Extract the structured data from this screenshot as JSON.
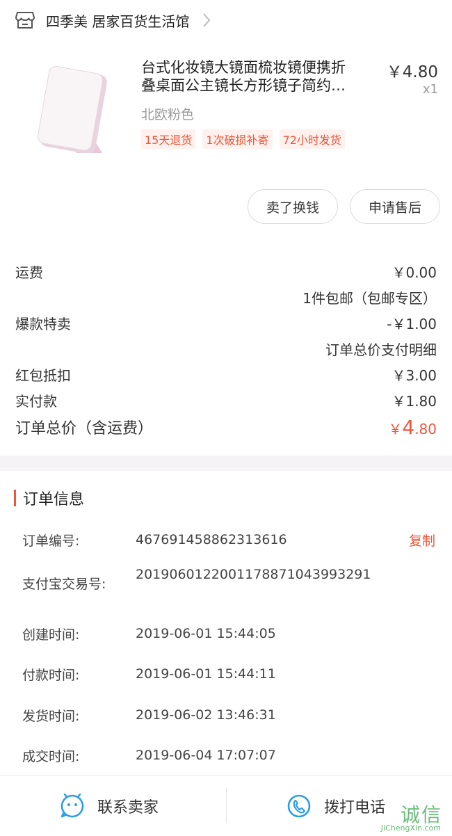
{
  "shop": {
    "name": "四季美 居家百货生活馆"
  },
  "product": {
    "title_line1": "台式化妆镜大镜面梳妆镜便携折",
    "title_line2": "叠桌面公主镜长方形镜子简约…",
    "price": "￥4.80",
    "qty": "x1",
    "variant": "北欧粉色",
    "tags": [
      "15天退货",
      "1次破损补寄",
      "72小时发货"
    ]
  },
  "actions": {
    "sell": "卖了换钱",
    "after_sale": "申请售后"
  },
  "summary": {
    "shipping_label": "运费",
    "shipping_value": "￥0.00",
    "shipping_note": "1件包邮（包邮专区）",
    "hot_label": "爆款特卖",
    "hot_value": "-￥1.00",
    "detail_link": "订单总价支付明细",
    "redpacket_label": "红包抵扣",
    "redpacket_value": "￥3.00",
    "paid_label": "实付款",
    "paid_value": "￥1.80",
    "total_label": "订单总价（含运费）",
    "total_currency": "￥",
    "total_int": "4",
    "total_dec": ".80"
  },
  "order_info": {
    "title": "订单信息",
    "order_no_label": "订单编号:",
    "order_no": "467691458862313616",
    "copy": "复制",
    "alipay_label": "支付宝交易号:",
    "alipay_no": "2019060122001178871043993291",
    "created_label": "创建时间:",
    "created": "2019-06-01 15:44:05",
    "paid_label": "付款时间:",
    "paid": "2019-06-01 15:44:11",
    "shipped_label": "发货时间:",
    "shipped": "2019-06-02 13:46:31",
    "done_label": "成交时间:",
    "done": "2019-06-04 17:07:07"
  },
  "bottom": {
    "contact": "联系卖家",
    "call": "拨打电话"
  },
  "watermark": {
    "cn": "诚信",
    "en": "JiChengXin.com"
  },
  "colors": {
    "accent": "#f0553a",
    "blue": "#2d9de8",
    "watermark": "#3aa84f"
  }
}
